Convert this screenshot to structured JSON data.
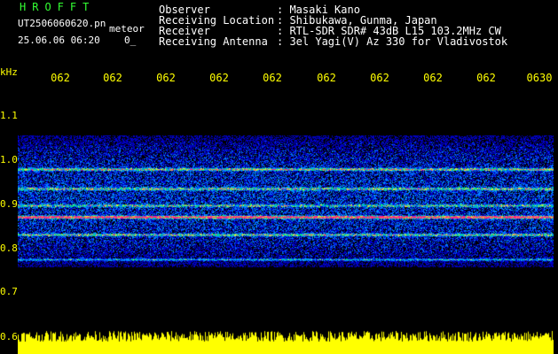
{
  "header": {
    "app_name": "HROFFT",
    "file_name": "UT2506060620.pn",
    "mode": "meteor",
    "datetime": "25.06.06 06:20",
    "count": "0_"
  },
  "info": [
    {
      "label": "Observer",
      "value": ": Masaki Kano"
    },
    {
      "label": "Receiving Location",
      "value": ": Shibukawa, Gunma, Japan"
    },
    {
      "label": "Receiver",
      "value": ": RTL-SDR SDR# 43dB L15 103.2MHz CW"
    },
    {
      "label": "Receiving Antenna",
      "value": ": 3el Yagi(V) Az 330 for Vladivostok"
    }
  ],
  "axes": {
    "unit": "kHz",
    "time_ticks": [
      "062",
      "062",
      "062",
      "062",
      "062",
      "062",
      "062",
      "062",
      "062",
      "0630"
    ],
    "freq_ticks": [
      "1.1",
      "1.0",
      "0.9",
      "0.8",
      "0.7",
      "0.6"
    ]
  },
  "colors": {
    "title": "#33ff33",
    "info_text": "#ffffff",
    "axis_text": "#ffff00",
    "background": "#000000",
    "carrier": "#ff2080",
    "noise_bar": "#ffff00"
  }
}
